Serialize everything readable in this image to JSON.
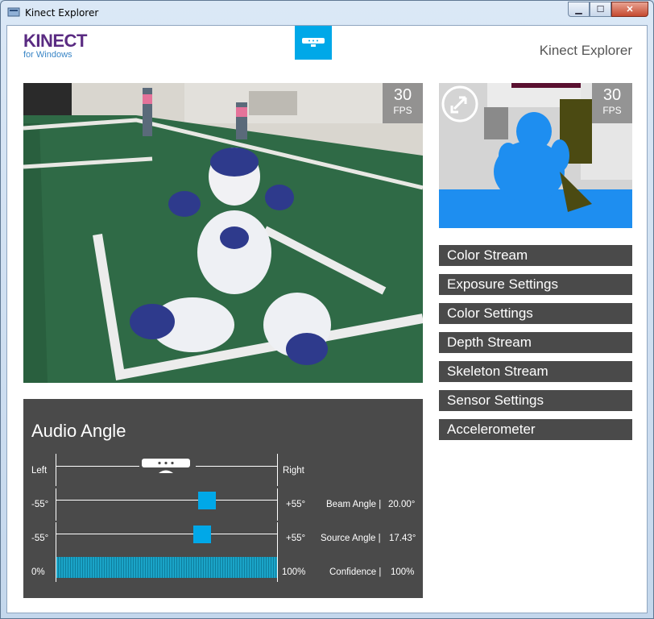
{
  "window": {
    "title": "Kinect Explorer",
    "controls": {
      "minimize": "▁",
      "maximize": "☐",
      "close": "✕"
    }
  },
  "header": {
    "logo_main": "KINECT",
    "logo_sub": "for Windows",
    "app_title": "Kinect Explorer",
    "sensor_icon": "kinect-sensor-icon"
  },
  "color_view": {
    "fps_value": "30",
    "fps_label": "FPS"
  },
  "depth_view": {
    "fps_value": "30",
    "fps_label": "FPS",
    "toggle_icon": "swap-arrows-icon"
  },
  "menu": {
    "items": [
      {
        "label": "Color Stream"
      },
      {
        "label": "Exposure Settings"
      },
      {
        "label": "Color Settings"
      },
      {
        "label": "Depth Stream"
      },
      {
        "label": "Skeleton Stream"
      },
      {
        "label": "Sensor Settings"
      },
      {
        "label": "Accelerometer"
      }
    ]
  },
  "audio": {
    "title": "Audio Angle",
    "direction": {
      "left_label": "Left",
      "right_label": "Right"
    },
    "beam": {
      "min_label": "-55°",
      "max_label": "+55°",
      "name": "Beam Angle |",
      "value_text": "20.00°",
      "value": 20.0
    },
    "source": {
      "min_label": "-55°",
      "max_label": "+55°",
      "name": "Source Angle |",
      "value_text": "17.43°",
      "value": 17.43
    },
    "confidence": {
      "min_label": "0%",
      "max_label": "100%",
      "name": "Confidence |",
      "value_text": "100%",
      "value": 1.0
    }
  },
  "colors": {
    "accent": "#00a8e8",
    "panel": "#4a4a4a",
    "brand_purple": "#5a2b82"
  }
}
